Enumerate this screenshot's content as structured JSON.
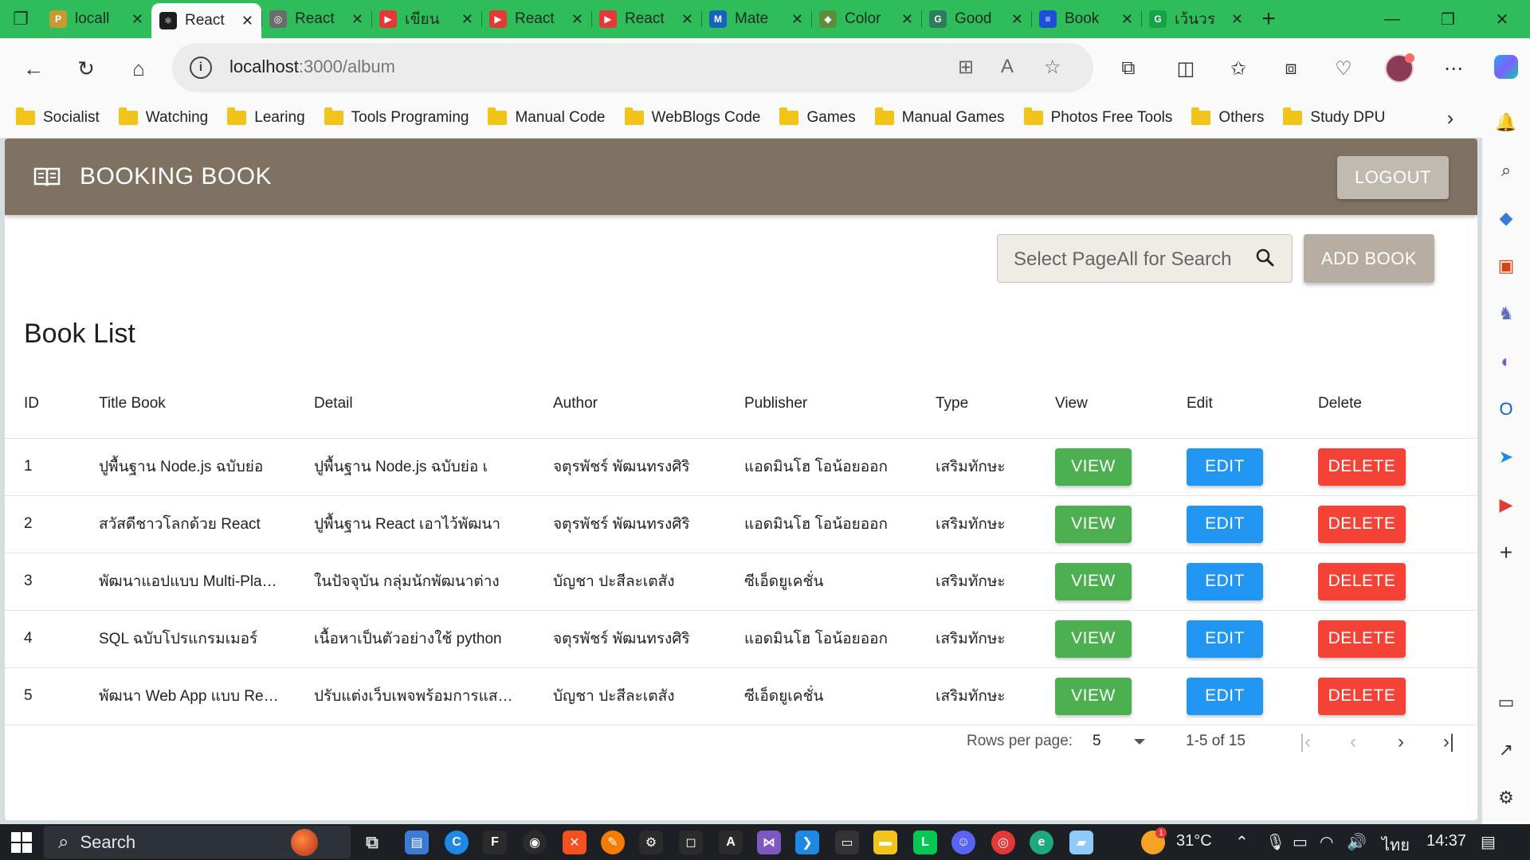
{
  "browser": {
    "tabs": [
      {
        "title": "locall",
        "color": "#c79a2e",
        "mark": "P"
      },
      {
        "title": "React",
        "color": "#1e1e1e",
        "mark": "⚛",
        "active": true
      },
      {
        "title": "React",
        "color": "#6c6c6c",
        "mark": "◎"
      },
      {
        "title": "เขียน",
        "color": "#e53935",
        "mark": "▶"
      },
      {
        "title": "React",
        "color": "#e53935",
        "mark": "▶"
      },
      {
        "title": "React",
        "color": "#e53935",
        "mark": "▶"
      },
      {
        "title": "Mate",
        "color": "#1565c0",
        "mark": "M"
      },
      {
        "title": "Color",
        "color": "#5d8f3a",
        "mark": "◆"
      },
      {
        "title": "Good",
        "color": "#2e7d5a",
        "mark": "G"
      },
      {
        "title": "Book",
        "color": "#1e4fd8",
        "mark": "≡"
      },
      {
        "title": "เว้นวร",
        "color": "#15a34a",
        "mark": "G"
      }
    ],
    "address": {
      "host": "localhost",
      "port_path": ":3000/album"
    },
    "bookmarks": [
      "Socialist",
      "Watching",
      "Learing",
      "Tools Programing",
      "Manual Code",
      "WebBlogs Code",
      "Games",
      "Manual Games",
      "Photos Free Tools",
      "Others",
      "Study DPU"
    ]
  },
  "app": {
    "brand": "BOOKING BOOK",
    "logout_label": "LOGOUT",
    "search_placeholder": "Select PageAll for Search",
    "add_book_label": "ADD BOOK",
    "list_title": "Book List",
    "columns": {
      "id": "ID",
      "title": "Title Book",
      "detail": "Detail",
      "author": "Author",
      "publisher": "Publisher",
      "type": "Type",
      "view": "View",
      "edit": "Edit",
      "delete": "Delete"
    },
    "rows": [
      {
        "id": "1",
        "title": "ปูพื้นฐาน Node.js ฉบับย่อ",
        "detail": "ปูพื้นฐาน Node.js ฉบับย่อ เ",
        "author": "จตุรพัชร์ พัฒนทรงศิริ",
        "publisher": "แอดมินโฮ โอน้อยออก",
        "type": "เสริมทักษะ"
      },
      {
        "id": "2",
        "title": "สวัสดีชาวโลกด้วย React",
        "detail": "ปูพื้นฐาน React เอาไว้พัฒนา",
        "author": "จตุรพัชร์ พัฒนทรงศิริ",
        "publisher": "แอดมินโฮ โอน้อยออก",
        "type": "เสริมทักษะ"
      },
      {
        "id": "3",
        "title": "พัฒนาแอปแบบ Multi-Platform",
        "detail": "ในปัจจุบัน กลุ่มนักพัฒนาต่าง",
        "author": "บัญชา ปะสีละเตสัง",
        "publisher": "ซีเอ็ดยูเคชั่น",
        "type": "เสริมทักษะ"
      },
      {
        "id": "4",
        "title": "SQL ฉบับโปรแกรมเมอร์",
        "detail": "เนื้อหาเป็นตัวอย่างใช้ python",
        "author": "จตุรพัชร์ พัฒนทรงศิริ",
        "publisher": "แอดมินโฮ โอน้อยออก",
        "type": "เสริมทักษะ"
      },
      {
        "id": "5",
        "title": "พัฒนา Web App แบบ React",
        "detail": "ปรับแต่งเว็บเพจพร้อมการแสดงผล",
        "author": "บัญชา ปะสีละเตสัง",
        "publisher": "ซีเอ็ดยูเคชั่น",
        "type": "เสริมทักษะ"
      }
    ],
    "button_labels": {
      "view": "VIEW",
      "edit": "EDIT",
      "delete": "DELETE"
    },
    "pagination": {
      "rows_per_page_label": "Rows per page:",
      "rows_per_page_value": "5",
      "range": "1-5 of 15"
    }
  },
  "taskbar": {
    "search_label": "Search",
    "temperature": "31°C",
    "language": "ไทย",
    "time": "14:37",
    "weather_badge": "1"
  },
  "colors": {
    "tabbar": "#2fbc5b",
    "appbar": "#7f7262",
    "view": "#4caf50",
    "edit": "#2196f3",
    "delete": "#f44336"
  }
}
